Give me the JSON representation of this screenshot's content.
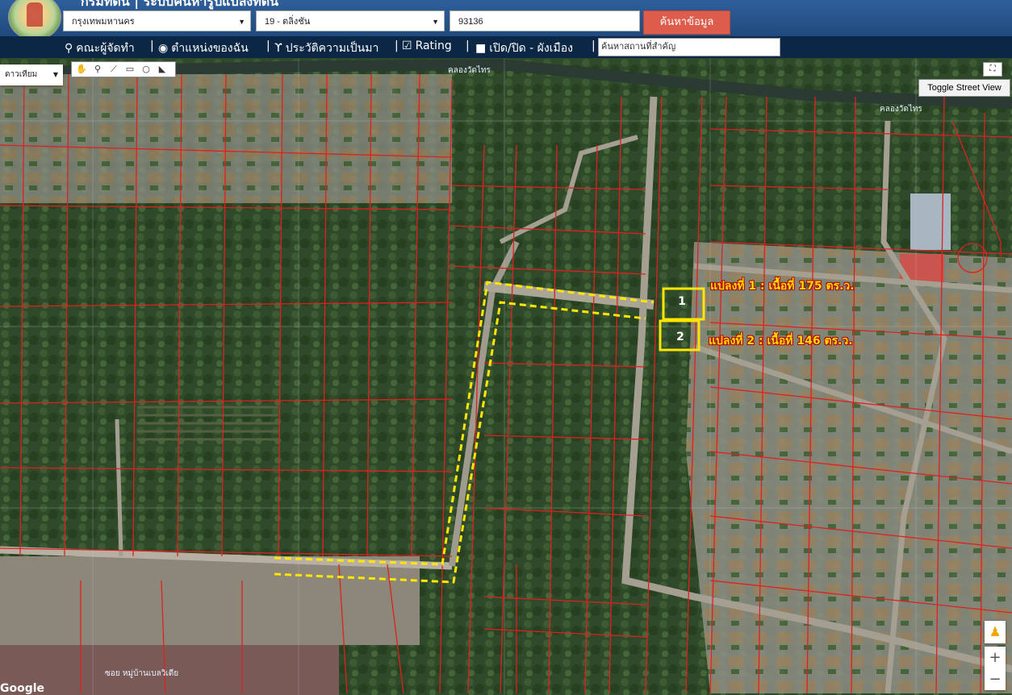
{
  "header": {
    "title": "กรมที่ดิน | ระบบค้นหารูปแปลงที่ดิน",
    "province": "กรุงเทพมหานคร",
    "district": "19 - ตลิ่งชัน",
    "parcel_number": "93136",
    "search_button": "ค้นหาข้อมูล"
  },
  "navbar": {
    "items": [
      {
        "label": "คณะผู้จัดทำ",
        "icon": "person-icon"
      },
      {
        "label": "ตำแหน่งของฉัน",
        "icon": "globe-icon"
      },
      {
        "label": "ประวัติความเป็นมา",
        "icon": "history-icon"
      },
      {
        "label": "Rating",
        "icon": "chart-icon"
      },
      {
        "label": "เปิด/ปิด - ผังเมือง",
        "icon": "checkbox-icon"
      }
    ],
    "place_search_placeholder": "ค้นหาสถานที่สำคัญ"
  },
  "map": {
    "map_type": "ดาวเทียม",
    "street_view_button": "Toggle Street View",
    "zoom_in": "+",
    "zoom_out": "−",
    "canal_label": "คลองวัดไทร",
    "canal_label_2": "คลองวัดไทร",
    "soi_label": "ซอย หมู่บ้านเบลวิเดีย",
    "attribution": "Google",
    "plots": [
      {
        "number": "1",
        "label": "แปลงที่ 1 : เนื้อที่ 175 ตร.ว."
      },
      {
        "number": "2",
        "label": "แปลงที่ 2 : เนื้อที่ 146 ตร.ว."
      }
    ],
    "colors": {
      "parcel_lines": "#e02020",
      "highlight": "#ffe600"
    }
  }
}
